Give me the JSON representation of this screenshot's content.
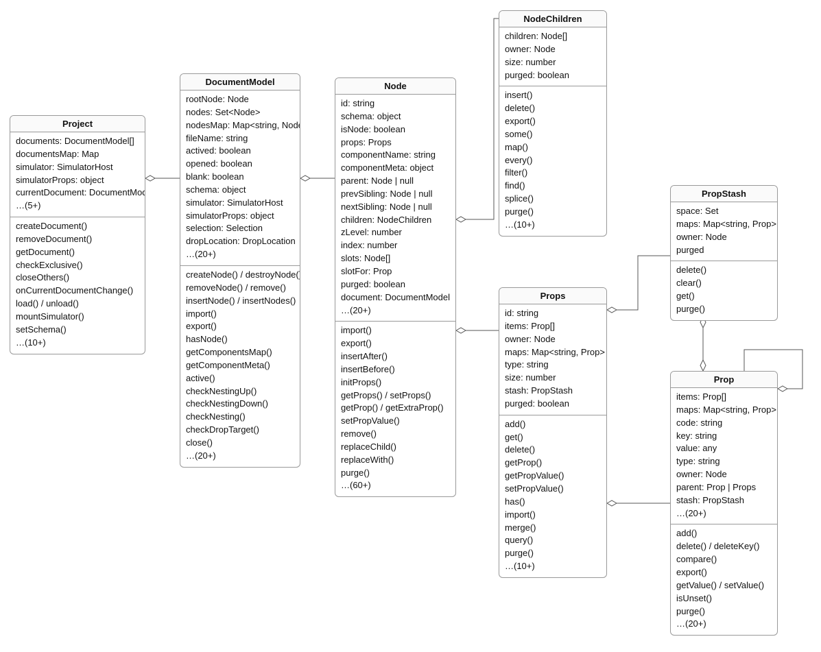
{
  "classes": {
    "project": {
      "title": "Project",
      "attrs": [
        "documents: DocumentModel[]",
        "documentsMap: Map",
        "simulator: SimulatorHost",
        "simulatorProps: object",
        "currentDocument: DocumentModel",
        "…(5+)"
      ],
      "methods": [
        "createDocument()",
        "removeDocument()",
        "getDocument()",
        "checkExclusive()",
        "closeOthers()",
        "onCurrentDocumentChange()",
        "load() / unload()",
        "mountSimulator()",
        "setSchema()",
        "…(10+)"
      ]
    },
    "documentModel": {
      "title": "DocumentModel",
      "attrs": [
        "rootNode: Node",
        "nodes: Set<Node>",
        "nodesMap: Map<string, Node>",
        "fileName: string",
        "actived: boolean",
        "opened: boolean",
        "blank: boolean",
        "schema: object",
        "simulator: SimulatorHost",
        "simulatorProps: object",
        "selection: Selection",
        "dropLocation: DropLocation",
        "…(20+)"
      ],
      "methods": [
        "createNode() / destroyNode()",
        "removeNode() / remove()",
        "insertNode() / insertNodes()",
        "import()",
        "export()",
        "hasNode()",
        "getComponentsMap()",
        "getComponentMeta()",
        "active()",
        "checkNestingUp()",
        "checkNestingDown()",
        "checkNesting()",
        "checkDropTarget()",
        "close()",
        "…(20+)"
      ]
    },
    "node": {
      "title": "Node",
      "attrs": [
        "id: string",
        "schema: object",
        "isNode: boolean",
        "props: Props",
        "componentName: string",
        "componentMeta: object",
        "parent: Node | null",
        "prevSibling: Node | null",
        "nextSibling: Node | null",
        "children: NodeChildren",
        "zLevel: number",
        "index: number",
        "slots: Node[]",
        "slotFor: Prop",
        "purged: boolean",
        "document: DocumentModel",
        "…(20+)"
      ],
      "methods": [
        "import()",
        "export()",
        "insertAfter()",
        "insertBefore()",
        "initProps()",
        "getProps() / setProps()",
        "getProp() / getExtraProp()",
        "setPropValue()",
        "remove()",
        "replaceChild()",
        "replaceWith()",
        "purge()",
        "…(60+)"
      ]
    },
    "nodeChildren": {
      "title": "NodeChildren",
      "attrs": [
        "children: Node[]",
        "owner: Node",
        "size: number",
        "purged: boolean"
      ],
      "methods": [
        "insert()",
        "delete()",
        "export()",
        "some()",
        "map()",
        "every()",
        "filter()",
        "find()",
        "splice()",
        "purge()",
        "…(10+)"
      ]
    },
    "props": {
      "title": "Props",
      "attrs": [
        "id: string",
        "items: Prop[]",
        "owner: Node",
        "maps: Map<string, Prop>",
        "type: string",
        "size: number",
        "stash: PropStash",
        "purged: boolean"
      ],
      "methods": [
        "add()",
        "get()",
        "delete()",
        "getProp()",
        "getPropValue()",
        "setPropValue()",
        "has()",
        "import()",
        "merge()",
        "query()",
        "purge()",
        "…(10+)"
      ]
    },
    "propStash": {
      "title": "PropStash",
      "attrs": [
        "space: Set",
        "maps: Map<string, Prop>",
        "owner: Node",
        "purged"
      ],
      "methods": [
        "delete()",
        "clear()",
        "get()",
        "purge()"
      ]
    },
    "prop": {
      "title": "Prop",
      "attrs": [
        "items: Prop[]",
        "maps: Map<string, Prop>",
        "code: string",
        "key: string",
        "value: any",
        "type: string",
        "owner: Node",
        "parent: Prop | Props",
        "stash: PropStash",
        "…(20+)"
      ],
      "methods": [
        "add()",
        "delete() / deleteKey()",
        "compare()",
        "export()",
        "getValue() / setValue()",
        "isUnset()",
        "purge()",
        "…(20+)"
      ]
    }
  },
  "connectors": [
    {
      "from": "project",
      "to": "documentModel",
      "type": "aggregation",
      "description": "Project ◇—— DocumentModel"
    },
    {
      "from": "documentModel",
      "to": "node",
      "type": "aggregation",
      "description": "DocumentModel ◇—— Node"
    },
    {
      "from": "node",
      "to": "nodeChildren",
      "type": "aggregation",
      "description": "Node ◇—— NodeChildren"
    },
    {
      "from": "node",
      "to": "props",
      "type": "aggregation",
      "description": "Node ◇—— Props"
    },
    {
      "from": "props",
      "to": "propStash",
      "type": "aggregation",
      "description": "Props ◇—— PropStash"
    },
    {
      "from": "props",
      "to": "prop",
      "type": "aggregation",
      "description": "Props ◇—— Prop"
    },
    {
      "from": "propStash",
      "to": "prop",
      "type": "aggregation-bidir",
      "description": "PropStash ◇——◇ Prop"
    },
    {
      "from": "prop",
      "to": "prop",
      "type": "aggregation-self",
      "description": "Prop ◇—— Prop (self)"
    }
  ]
}
